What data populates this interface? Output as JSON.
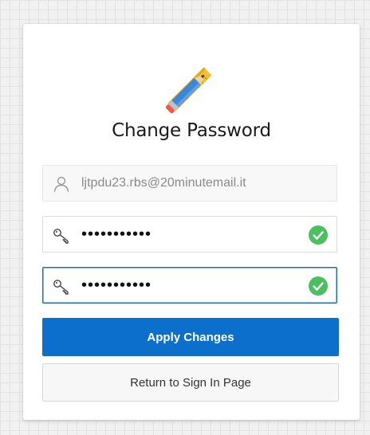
{
  "page": {
    "title": "Change Password",
    "logo_icon": "pencil-ruler-icon"
  },
  "form": {
    "username": {
      "value": "ljtpdu23.rbs@20minutemail.it",
      "icon": "user-icon"
    },
    "new_password": {
      "value": "•••••••••••",
      "icon": "key-icon",
      "status_icon": "check-circle-icon"
    },
    "confirm_password": {
      "value": "•••••••••••",
      "icon": "key-icon",
      "status_icon": "check-circle-icon"
    }
  },
  "actions": {
    "apply_label": "Apply Changes",
    "return_label": "Return to Sign In Page"
  },
  "colors": {
    "primary": "#0b6fcb",
    "success": "#4cc05f",
    "focus_border": "#1f6fae"
  }
}
